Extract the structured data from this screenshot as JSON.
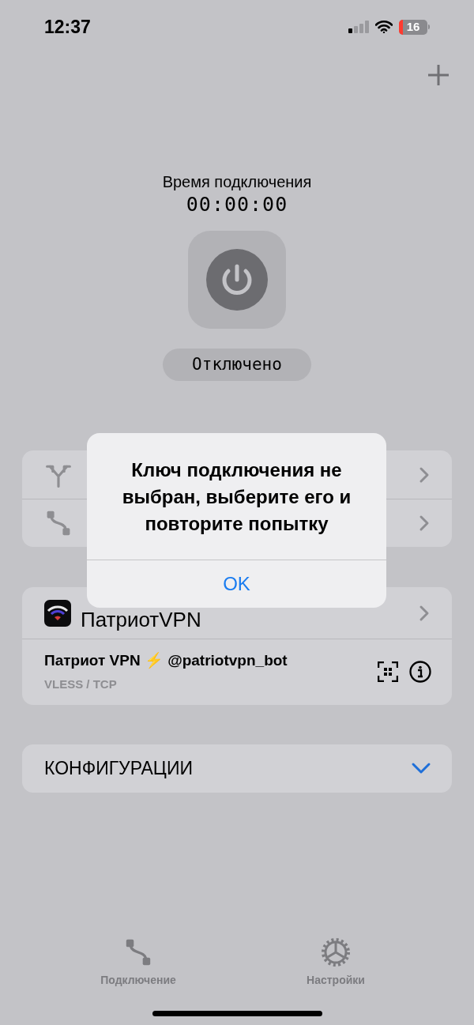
{
  "status_bar": {
    "time": "12:37",
    "battery": "16"
  },
  "connection": {
    "label": "Время подключения",
    "timer": "00:00:00",
    "state": "Отключено"
  },
  "menu_rows": [
    {
      "kind": "routing"
    },
    {
      "kind": "connection"
    }
  ],
  "provider": {
    "name": "ПатриотVPN",
    "item_title": "Патриот VPN ⚡ @patriotvpn_bot",
    "item_protocol": "VLESS / TCP"
  },
  "configurations": {
    "title": "КОНФИГУРАЦИИ",
    "expanded": false
  },
  "alert": {
    "message": "Ключ подключения не выбран, выберите его и повторите попытку",
    "button": "OK"
  },
  "tabs": [
    {
      "label": "Подключение",
      "kind": "connection"
    },
    {
      "label": "Настройки",
      "kind": "settings"
    }
  ]
}
